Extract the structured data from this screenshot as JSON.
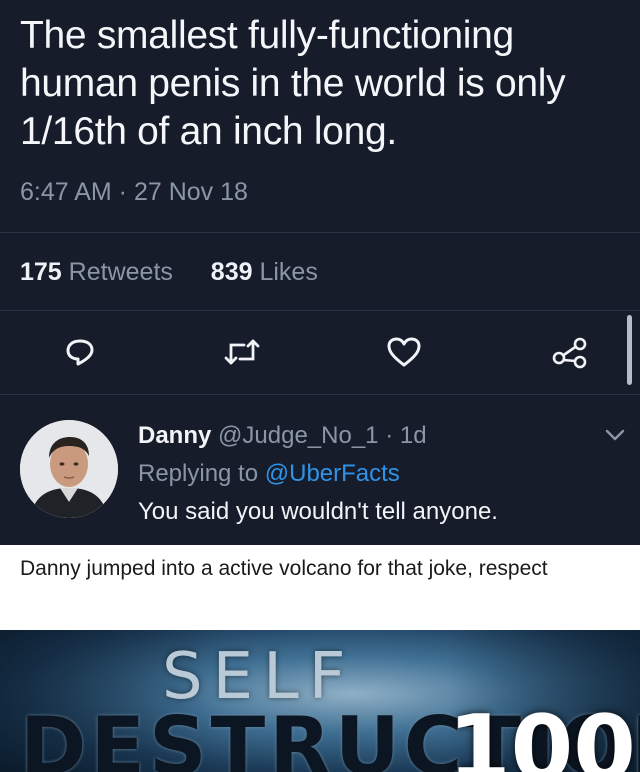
{
  "tweet": {
    "text": "The smallest fully-functioning human penis in the world is only 1/16th of an inch long.",
    "timestamp": "6:47 AM · 27 Nov 18",
    "retweets_count": "175",
    "retweets_label": "Retweets",
    "likes_count": "839",
    "likes_label": "Likes"
  },
  "actions": {
    "reply_icon": "reply-icon",
    "retweet_icon": "retweet-icon",
    "like_icon": "heart-icon",
    "share_icon": "share-icon"
  },
  "reply": {
    "name": "Danny",
    "handle": "@Judge_No_1",
    "time": "· 1d",
    "replying_prefix": "Replying to",
    "replying_handle": "@UberFacts",
    "text": "You said you wouldn't tell anyone."
  },
  "caption": {
    "text": "Danny jumped into a active volcano for that joke, respect"
  },
  "meme": {
    "line1": "SELF",
    "line2": "DESTRUCTION",
    "number": "100"
  },
  "colors": {
    "background": "#161c2a",
    "text_primary": "#f4f6fa",
    "text_secondary": "#8a96a6",
    "link": "#2f93e8",
    "caption_background": "#ffffff"
  }
}
